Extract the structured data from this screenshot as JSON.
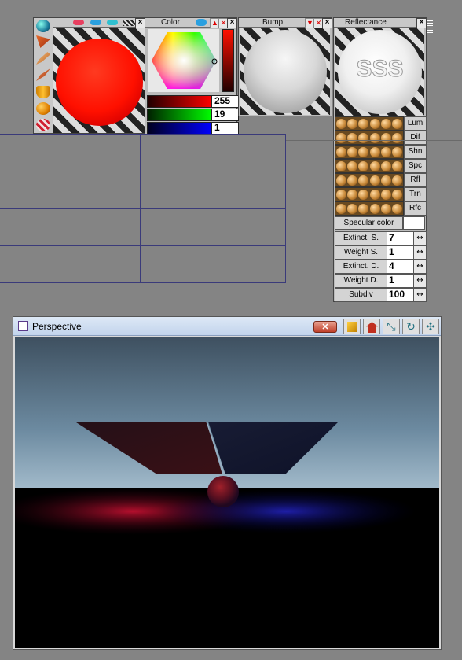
{
  "panels": {
    "color": {
      "title": "Color",
      "red": "255",
      "green": "19",
      "blue": "1"
    },
    "bump": {
      "title": "Bump"
    },
    "reflectance": {
      "title": "Reflectance",
      "preview_text": "SSS"
    }
  },
  "material_buttons": [
    "Lum",
    "Dif",
    "Shn",
    "Spc",
    "Rfl",
    "Trn",
    "Rfc"
  ],
  "specular": {
    "label": "Specular color"
  },
  "params": [
    {
      "label": "Extinct. S.",
      "value": "7"
    },
    {
      "label": "Weight S.",
      "value": "1"
    },
    {
      "label": "Extinct. D.",
      "value": "4"
    },
    {
      "label": "Weight D.",
      "value": "1"
    },
    {
      "label": "Subdiv",
      "value": "100"
    }
  ],
  "viewport": {
    "title": "Perspective"
  },
  "icons": {
    "tool_icons": [
      "sphere-icon",
      "cone-icon",
      "pencil-icon",
      "paint-icon",
      "cylinder-icon",
      "ball-icon",
      "texture-icon"
    ],
    "viewport_icons": [
      "cube-icon",
      "house-icon",
      "axes-icon",
      "rotate-icon",
      "move-icon"
    ]
  },
  "colors": {
    "accent_red": "#ff1a0a",
    "viewport_header": "#c8d8ec"
  }
}
